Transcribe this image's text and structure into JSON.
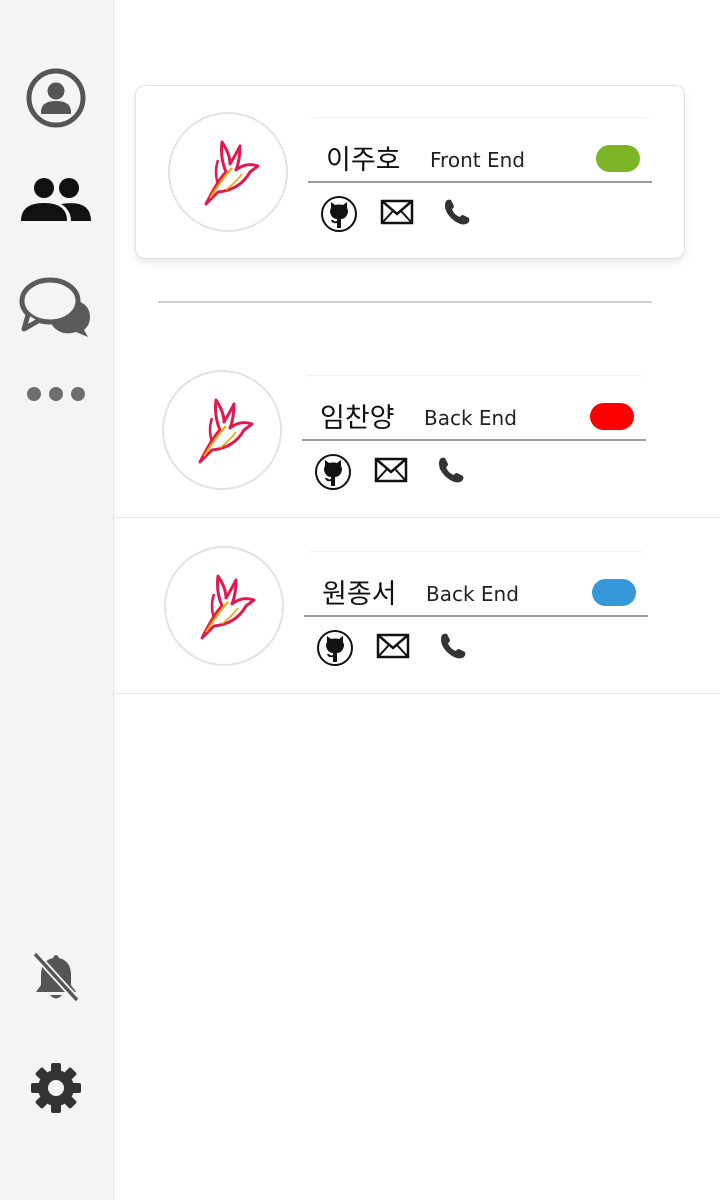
{
  "sidebar": {
    "items": [
      {
        "icon": "profile-icon"
      },
      {
        "icon": "team-icon"
      },
      {
        "icon": "chat-icon"
      },
      {
        "icon": "more-icon"
      }
    ],
    "bottom": [
      {
        "icon": "notifications-off-icon"
      },
      {
        "icon": "settings-icon"
      }
    ]
  },
  "members": [
    {
      "name": "이주호",
      "role": "Front End",
      "status_color": "#7cb526",
      "avatar_icon": "bird-logo-icon"
    },
    {
      "name": "임찬양",
      "role": "Back End",
      "status_color": "#ff0000",
      "avatar_icon": "bird-logo-icon"
    },
    {
      "name": "원종서",
      "role": "Back End",
      "status_color": "#3498db",
      "avatar_icon": "bird-logo-icon"
    }
  ],
  "contact_icons": [
    "github-icon",
    "mail-icon",
    "phone-icon"
  ]
}
